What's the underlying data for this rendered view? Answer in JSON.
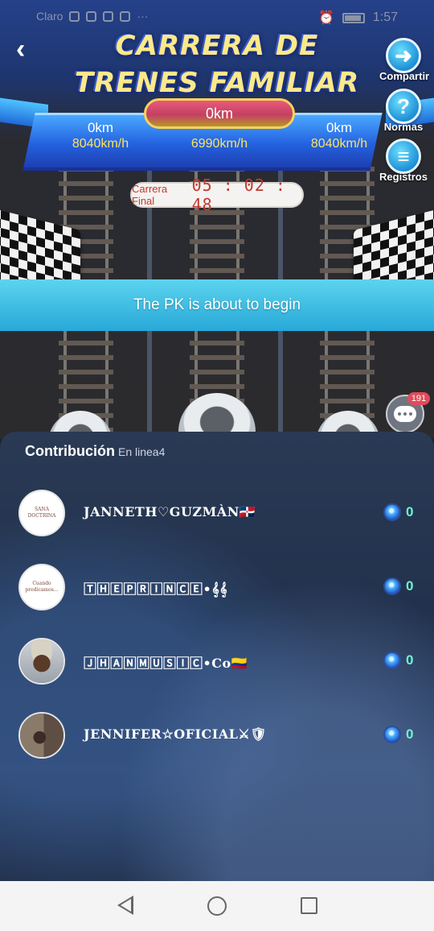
{
  "status_bar": {
    "carrier": "Claro",
    "time": "1:57"
  },
  "header": {
    "title_line1": "CARRERA DE",
    "title_line2": "TRENES FAMILIAR"
  },
  "side_buttons": {
    "share": "Compartir",
    "rules": "Normas",
    "logs": "Registros"
  },
  "race": {
    "center_distance": "0km",
    "lanes": [
      {
        "distance": "0km",
        "speed": "8040km/h"
      },
      {
        "distance": "",
        "speed": "6990km/h"
      },
      {
        "distance": "0km",
        "speed": "8040km/h"
      }
    ],
    "timer_label": "Carrera Final",
    "timer_value": "05 : 02 : 48",
    "notice": "The PK is about to begin"
  },
  "chat": {
    "badge_count": "191"
  },
  "contribution": {
    "title": "Contribución",
    "subtitle": "En linea4",
    "users": [
      {
        "name": "JANNETH♡GUZMÀN🇩🇴",
        "amount": "0",
        "avatar_text": "SANA DOCTRINA"
      },
      {
        "name": "🅃🄷🄴🄿🅁🄸🄽🄲🄴•𝄞𝄞",
        "amount": "0",
        "avatar_text": "Cuando predicamos..."
      },
      {
        "name": "🄹🄷🄰🄽🄼🅄🅂🄸🄲•Co🇨🇴",
        "amount": "0",
        "avatar_text": ""
      },
      {
        "name": "JENNIFER☆OFICIAL⚔🛡",
        "amount": "0",
        "avatar_text": ""
      }
    ]
  }
}
